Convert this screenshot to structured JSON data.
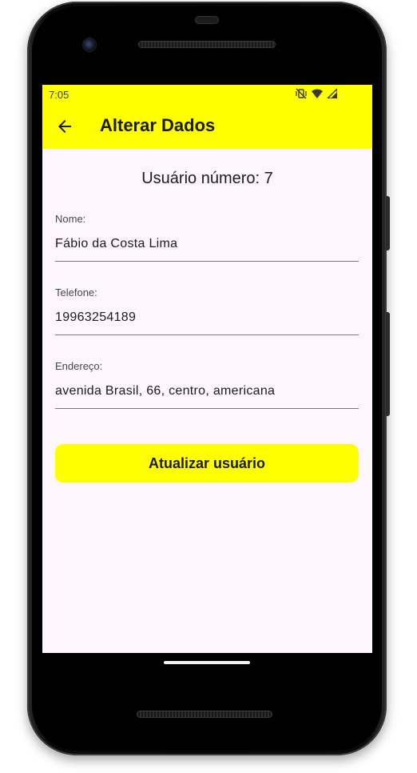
{
  "status_bar": {
    "time": "7:05",
    "icons": [
      "vibrate-off-icon",
      "wifi-icon",
      "signal-icon"
    ]
  },
  "app_bar": {
    "title": "Alterar Dados",
    "back_icon": "arrow-back-icon"
  },
  "user_number": "Usuário número: 7",
  "form": {
    "name": {
      "label": "Nome:",
      "value": "Fábio da Costa Lima"
    },
    "phone": {
      "label": "Telefone:",
      "value": "19963254189"
    },
    "address": {
      "label": "Endereço:",
      "value": "avenida Brasil, 66, centro, americana"
    }
  },
  "update_button_label": "Atualizar usuário",
  "colors": {
    "accent": "#ffff00",
    "background": "#fdf7fd",
    "text": "#1c1b1f"
  }
}
